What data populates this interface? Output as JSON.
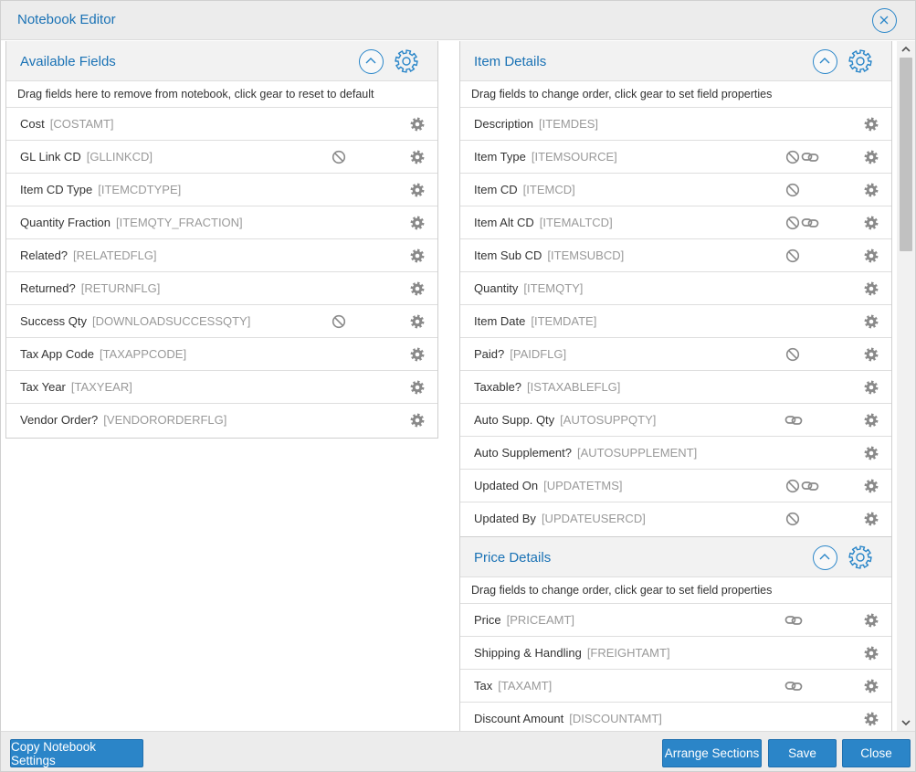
{
  "window": {
    "title": "Notebook Editor"
  },
  "available": {
    "title": "Available Fields",
    "hint": "Drag fields here to remove from notebook, click gear to reset to default",
    "rows": [
      {
        "label": "Cost",
        "code": "[COSTAMT]",
        "ban": false,
        "link": false
      },
      {
        "label": "GL Link CD",
        "code": "[GLLINKCD]",
        "ban": true,
        "link": false
      },
      {
        "label": "Item CD Type",
        "code": "[ITEMCDTYPE]",
        "ban": false,
        "link": false
      },
      {
        "label": "Quantity Fraction",
        "code": "[ITEMQTY_FRACTION]",
        "ban": false,
        "link": false
      },
      {
        "label": "Related?",
        "code": "[RELATEDFLG]",
        "ban": false,
        "link": false
      },
      {
        "label": "Returned?",
        "code": "[RETURNFLG]",
        "ban": false,
        "link": false
      },
      {
        "label": "Success Qty",
        "code": "[DOWNLOADSUCCESSQTY]",
        "ban": true,
        "link": false
      },
      {
        "label": "Tax App Code",
        "code": "[TAXAPPCODE]",
        "ban": false,
        "link": false
      },
      {
        "label": "Tax Year",
        "code": "[TAXYEAR]",
        "ban": false,
        "link": false
      },
      {
        "label": "Vendor Order?",
        "code": "[VENDORORDERFLG]",
        "ban": false,
        "link": false
      }
    ]
  },
  "item_details": {
    "title": "Item Details",
    "hint": "Drag fields to change order, click gear to set field properties",
    "rows": [
      {
        "label": "Description",
        "code": "[ITEMDES]",
        "ban": false,
        "link": false
      },
      {
        "label": "Item Type",
        "code": "[ITEMSOURCE]",
        "ban": true,
        "link": true
      },
      {
        "label": "Item CD",
        "code": "[ITEMCD]",
        "ban": true,
        "link": false
      },
      {
        "label": "Item Alt CD",
        "code": "[ITEMALTCD]",
        "ban": true,
        "link": true
      },
      {
        "label": "Item Sub CD",
        "code": "[ITEMSUBCD]",
        "ban": true,
        "link": false
      },
      {
        "label": "Quantity",
        "code": "[ITEMQTY]",
        "ban": false,
        "link": false
      },
      {
        "label": "Item Date",
        "code": "[ITEMDATE]",
        "ban": false,
        "link": false
      },
      {
        "label": "Paid?",
        "code": "[PAIDFLG]",
        "ban": true,
        "link": false
      },
      {
        "label": "Taxable?",
        "code": "[ISTAXABLEFLG]",
        "ban": false,
        "link": false
      },
      {
        "label": "Auto Supp. Qty",
        "code": "[AUTOSUPPQTY]",
        "ban": false,
        "link": true
      },
      {
        "label": "Auto Supplement?",
        "code": "[AUTOSUPPLEMENT]",
        "ban": false,
        "link": false
      },
      {
        "label": "Updated On",
        "code": "[UPDATETMS]",
        "ban": true,
        "link": true
      },
      {
        "label": "Updated By",
        "code": "[UPDATEUSERCD]",
        "ban": true,
        "link": false
      }
    ]
  },
  "price_details": {
    "title": "Price Details",
    "hint": "Drag fields to change order, click gear to set field properties",
    "rows": [
      {
        "label": "Price",
        "code": "[PRICEAMT]",
        "ban": false,
        "link": true
      },
      {
        "label": "Shipping & Handling",
        "code": "[FREIGHTAMT]",
        "ban": false,
        "link": false
      },
      {
        "label": "Tax",
        "code": "[TAXAMT]",
        "ban": false,
        "link": true
      },
      {
        "label": "Discount Amount",
        "code": "[DISCOUNTAMT]",
        "ban": false,
        "link": false
      }
    ]
  },
  "footer": {
    "copy_label": "Copy Notebook Settings",
    "arrange_label": "Arrange Sections",
    "save_label": "Save",
    "close_label": "Close"
  },
  "colors": {
    "accent": "#1a72b5",
    "button": "#2b85c8",
    "icon_gray": "#8a8a8a"
  },
  "icons": {
    "row_gear": "gear-icon",
    "row_ban": "disabled-icon",
    "row_link": "link-icon",
    "collapse": "chevron-up-icon",
    "close": "close-icon"
  }
}
